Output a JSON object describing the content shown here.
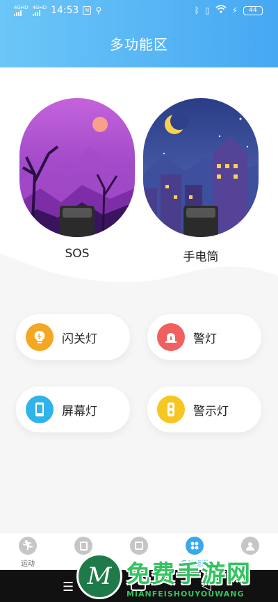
{
  "status_bar": {
    "network_1": "4GHD",
    "network_2": "4GHD",
    "time": "14:53",
    "battery": "44"
  },
  "header": {
    "title": "多功能区"
  },
  "cards": [
    {
      "label": "SOS",
      "icon": "sos-night-forest-illustration"
    },
    {
      "label": "手电筒",
      "icon": "flashlight-night-city-illustration"
    }
  ],
  "features": [
    {
      "label": "闪关灯",
      "icon": "bulb-icon",
      "color": "#f5a623"
    },
    {
      "label": "警灯",
      "icon": "siren-icon",
      "color": "#f0605f"
    },
    {
      "label": "屏幕灯",
      "icon": "phone-screen-icon",
      "color": "#2eb4ea"
    },
    {
      "label": "警示灯",
      "icon": "traffic-light-icon",
      "color": "#f6c623"
    }
  ],
  "nav": {
    "items": [
      {
        "label": "运动",
        "icon": "runner-icon"
      },
      {
        "label": "",
        "icon": "notes-icon"
      },
      {
        "label": "",
        "icon": "calendar-icon"
      },
      {
        "label": "多功能区",
        "icon": "apps-icon",
        "active": true
      },
      {
        "label": "",
        "icon": "profile-icon"
      }
    ]
  },
  "watermark": {
    "text": "免费手游网",
    "sub": "MIANFEISHOUYOUWANG",
    "logo_letter": "M"
  },
  "colors": {
    "header_from": "#6cc6f7",
    "header_to": "#46a8f3",
    "accent": "#3aa7ef"
  }
}
